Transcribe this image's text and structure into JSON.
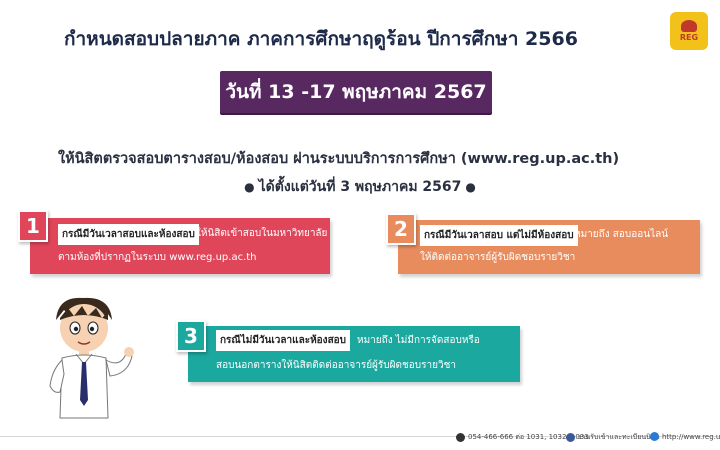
{
  "header": {
    "title": "กำหนดสอบปลายภาค ภาคการศึกษาฤดูร้อน ปีการศึกษา 2566",
    "logo_text": "REG"
  },
  "date_banner": "วันที่ 13 -17 พฤษภาคม 2567",
  "instruction": "ให้นิสิตตรวจสอบตารางสอบ/ห้องสอบ ผ่านระบบบริการการศึกษา (www.reg.up.ac.th)",
  "since": "ได้ตั้งแต่วันที่  3 พฤษภาคม 2567",
  "cards": [
    {
      "number": "1",
      "tag": "กรณีมีวันเวลาสอบและห้องสอบ",
      "line1": "ให้นิสิตเข้าสอบในมหาวิทยาลัย",
      "line2": "ตามห้องที่ปรากฏในระบบ www.reg.up.ac.th",
      "color": "#e0465a"
    },
    {
      "number": "2",
      "tag": "กรณีมีวันเวลาสอบ แต่ไม่มีห้องสอบ",
      "line1": "หมายถึง สอบออนไลน์",
      "line2": "ให้ติดต่ออาจารย์ผู้รับผิดชอบรายวิชา",
      "color": "#e88c5e"
    },
    {
      "number": "3",
      "tag": "กรณีไม่มีวันเวลาและห้องสอบ",
      "line1": "หมายถึง ไม่มีการจัดสอบหรือ",
      "line2": "สอบนอกตารางให้นิสิตติดต่ออาจารย์ผู้รับผิดชอบรายวิชา",
      "color": "#1ba89f"
    }
  ],
  "footer": {
    "phone": "054-466-666 ต่อ 1031, 1032, 1033",
    "facebook": "งานรับเข้าและทะเบียนนิสิต",
    "website": "http://www.reg.up.ac.th"
  }
}
